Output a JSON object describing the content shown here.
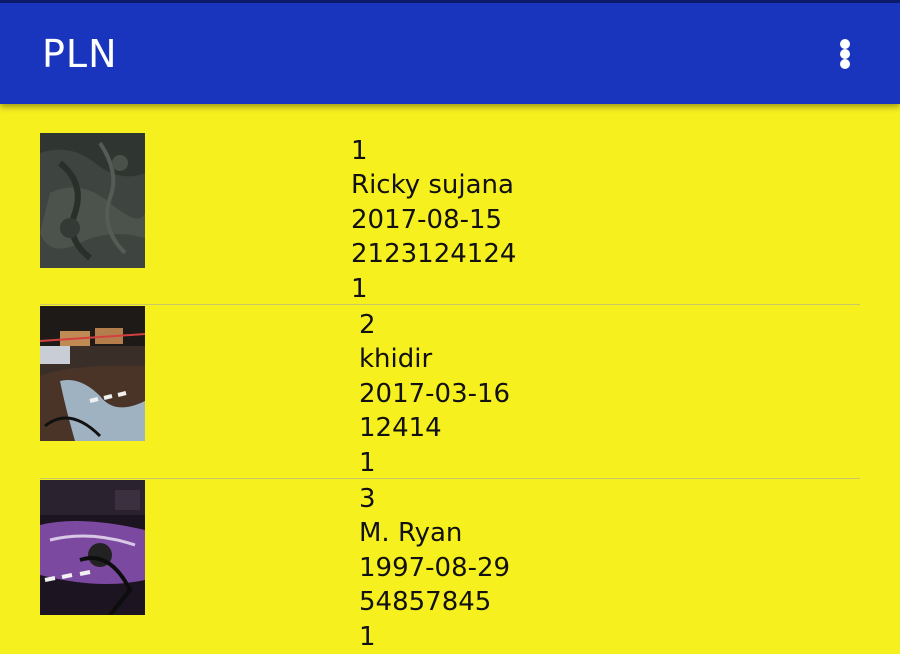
{
  "appbar": {
    "title": "PLN",
    "menu_icon": "more-vertical-icon"
  },
  "colors": {
    "appbar": "#1a35bd",
    "background": "#f7f01f",
    "text": "#111111"
  },
  "records": [
    {
      "id": "1",
      "name": "Ricky sujana",
      "date": "2017-08-15",
      "phone": "2123124124",
      "status": "1"
    },
    {
      "id": "2",
      "name": "khidir",
      "date": "2017-03-16",
      "phone": "12414",
      "status": "1"
    },
    {
      "id": "3",
      "name": "M. Ryan",
      "date": "1997-08-29",
      "phone": "54857845",
      "status": "1"
    }
  ]
}
